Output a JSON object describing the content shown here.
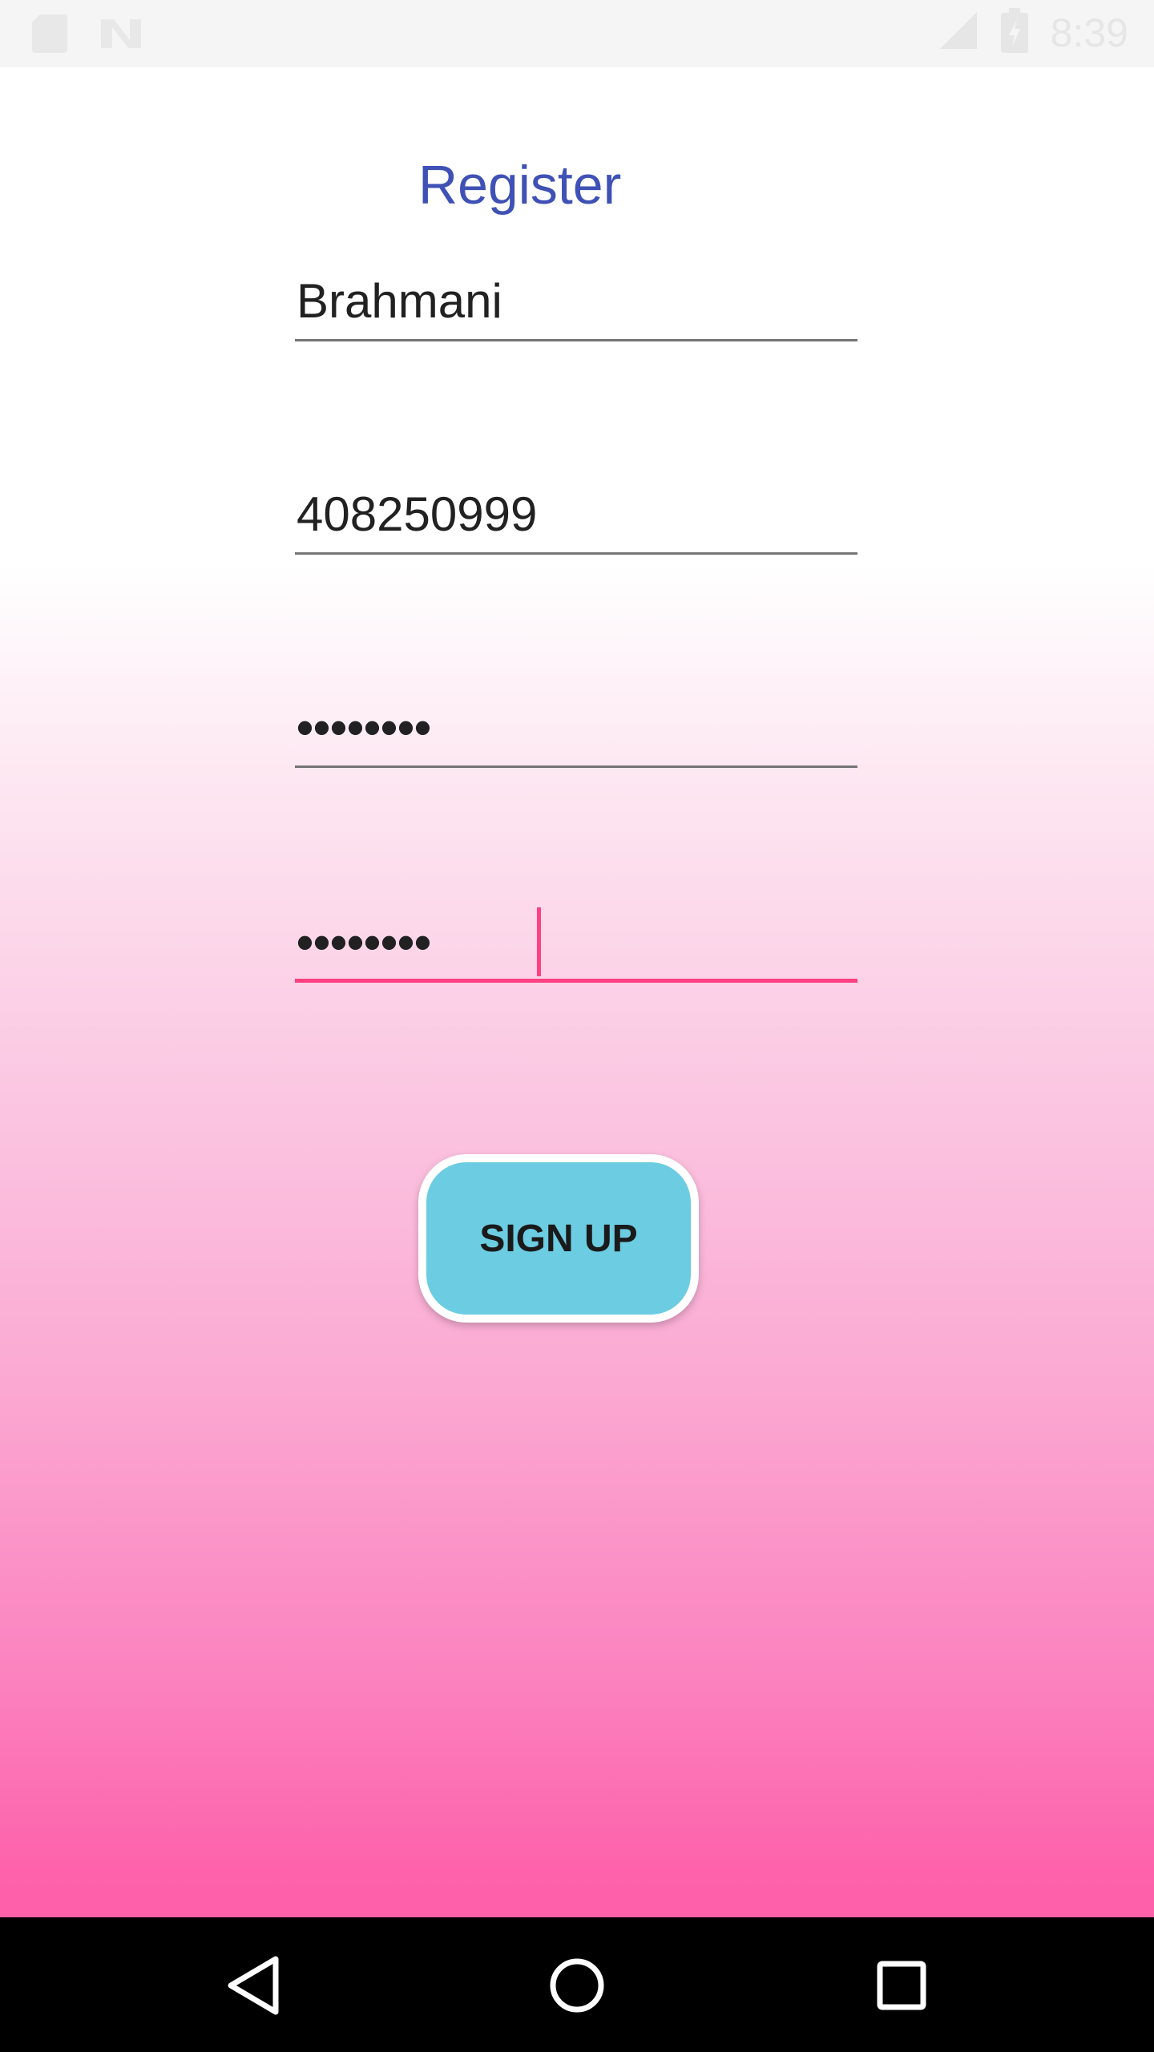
{
  "status_bar": {
    "time": "8:39",
    "icons": [
      "sd-card-icon",
      "no-sim-icon",
      "lte-signal-icon",
      "battery-charging-icon"
    ]
  },
  "form": {
    "title": "Register",
    "fields": [
      {
        "name": "name",
        "value": "Brahmani"
      },
      {
        "name": "phone",
        "value": "408250999"
      },
      {
        "name": "password",
        "value": "••••••••"
      },
      {
        "name": "confirm_password",
        "value": "••••••••"
      }
    ],
    "submit_label": "SIGN UP"
  },
  "colors": {
    "title": "#3f51b5",
    "accent": "#ff4081",
    "button": "#6ccce2",
    "gradient_bottom": "#fe60aa"
  },
  "nav_bar": {
    "icons": [
      "back-icon",
      "home-icon",
      "recents-icon"
    ]
  }
}
